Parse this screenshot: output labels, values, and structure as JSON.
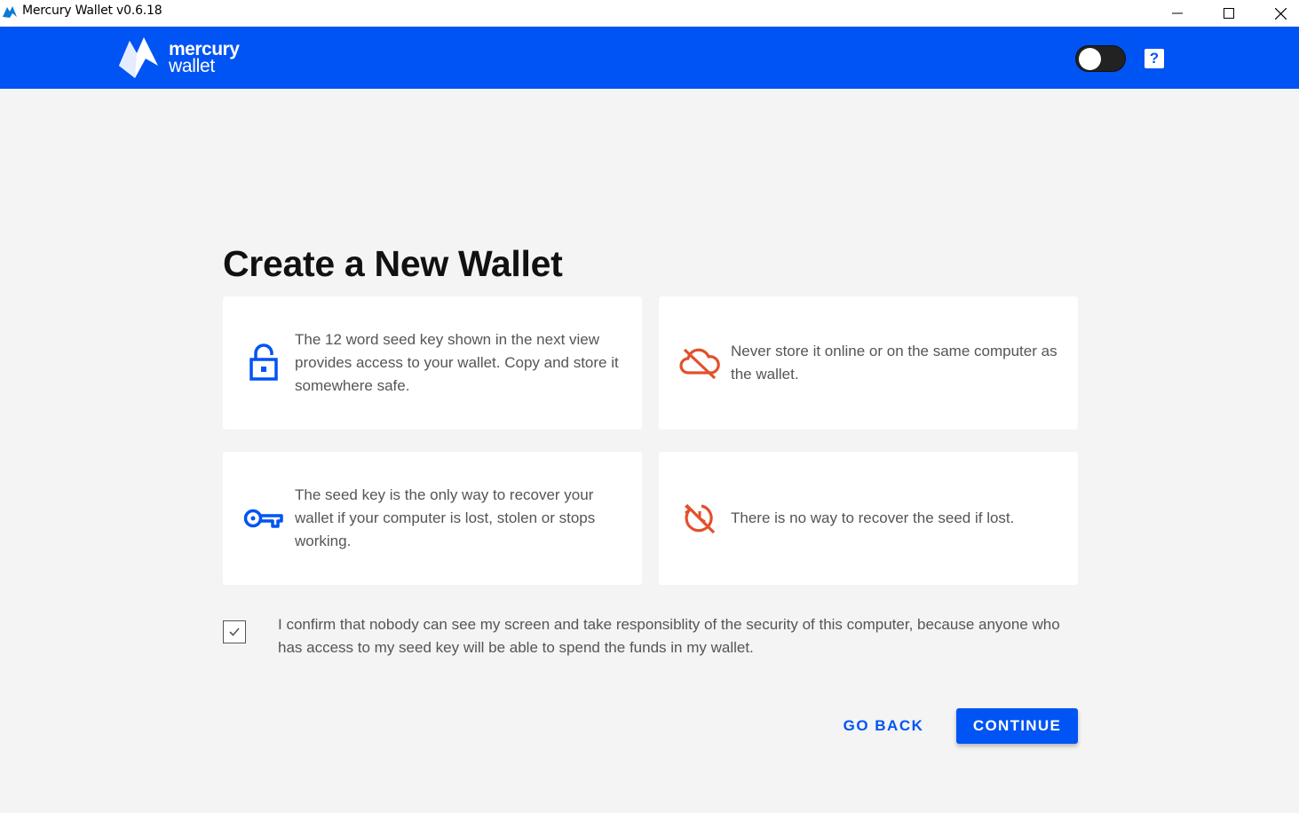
{
  "window": {
    "title": "Mercury Wallet v0.6.18",
    "icon": "mercury-logo-icon"
  },
  "header": {
    "logo_line1": "mercury",
    "logo_line2": "wallet",
    "toggle_icon": "dark-mode-toggle",
    "help_label": "?",
    "brand_color": "#0054f4"
  },
  "main": {
    "title": "Create a New Wallet",
    "cards": [
      {
        "icon": "unlock-icon",
        "icon_color": "#0054f4",
        "text": "The 12 word seed key shown in the next view provides access to your wallet. Copy and store it somewhere safe."
      },
      {
        "icon": "cloud-off-icon",
        "icon_color": "#e2502b",
        "text": "Never store it online or on the same computer as the wallet."
      },
      {
        "icon": "key-icon",
        "icon_color": "#0054f4",
        "text": "The seed key is the only way to recover your wallet if your computer is lost, stolen or stops working."
      },
      {
        "icon": "restore-off-icon",
        "icon_color": "#e2502b",
        "text": "There is no way to recover the seed if lost."
      }
    ],
    "confirm": {
      "checked": true,
      "text": "I confirm that nobody can see my screen and take responsiblity of the security of this computer, because anyone who has access to my seed key will be able to spend the funds in my wallet."
    },
    "buttons": {
      "back": "GO BACK",
      "continue": "CONTINUE"
    }
  }
}
